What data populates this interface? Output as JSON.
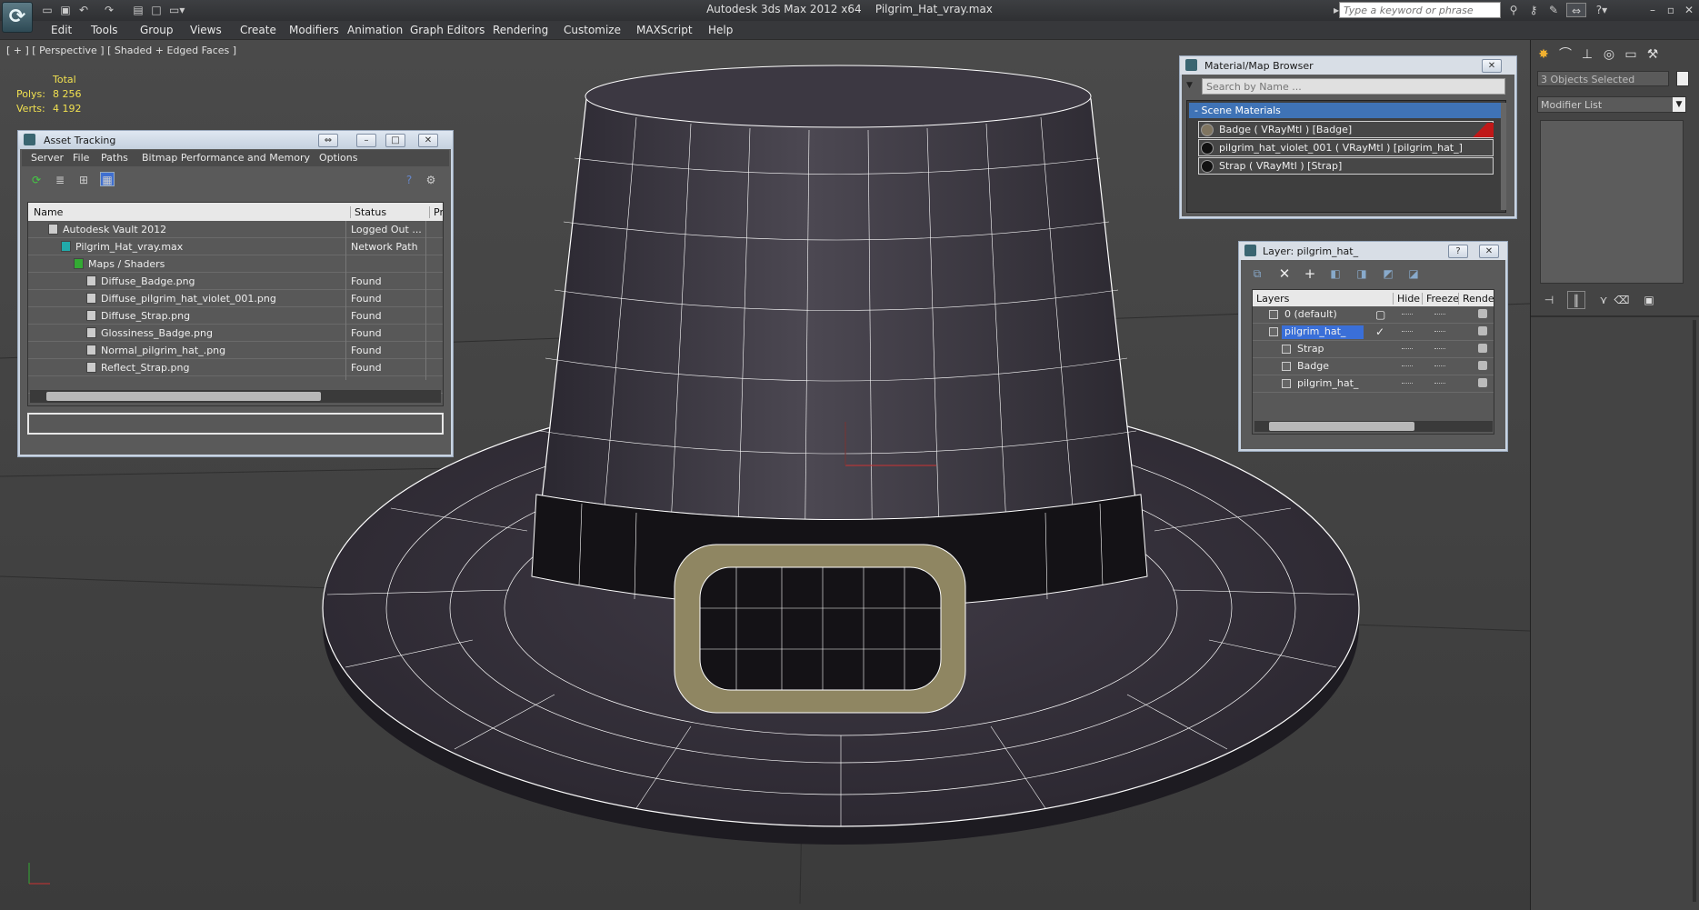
{
  "app": {
    "title": "Autodesk 3ds Max  2012 x64",
    "file": "Pilgrim_Hat_vray.max",
    "logo": "3ds-max-logo",
    "search_placeholder": "Type a keyword or phrase"
  },
  "menu": [
    "Edit",
    "Tools",
    "Group",
    "Views",
    "Create",
    "Modifiers",
    "Animation",
    "Graph Editors",
    "Rendering",
    "Customize",
    "MAXScript",
    "Help"
  ],
  "viewport": {
    "label": "[ + ] [ Perspective ] [ Shaded + Edged Faces ]",
    "stats": {
      "header": "Total",
      "polys_label": "Polys:",
      "polys": "8 256",
      "verts_label": "Verts:",
      "verts": "4 192"
    },
    "colors": {
      "bg": "#454545",
      "hat": "#3a3640",
      "wire": "#ffffff",
      "buckle": "#8f8662"
    }
  },
  "asset_tracking": {
    "title": "Asset Tracking",
    "menu": [
      "Server",
      "File",
      "Paths",
      "Bitmap Performance and Memory",
      "Options"
    ],
    "columns": [
      "Name",
      "Status",
      "Pro"
    ],
    "rows": [
      {
        "name": "Autodesk Vault 2012",
        "status": "Logged Out ...",
        "indent": 0,
        "icon": "vault-icon"
      },
      {
        "name": "Pilgrim_Hat_vray.max",
        "status": "Network Path",
        "indent": 1,
        "icon": "max-file-icon"
      },
      {
        "name": "Maps / Shaders",
        "status": "",
        "indent": 2,
        "icon": "maps-icon"
      },
      {
        "name": "Diffuse_Badge.png",
        "status": "Found",
        "indent": 3,
        "icon": "bitmap-icon"
      },
      {
        "name": "Diffuse_pilgrim_hat_violet_001.png",
        "status": "Found",
        "indent": 3,
        "icon": "bitmap-icon"
      },
      {
        "name": "Diffuse_Strap.png",
        "status": "Found",
        "indent": 3,
        "icon": "bitmap-icon"
      },
      {
        "name": "Glossiness_Badge.png",
        "status": "Found",
        "indent": 3,
        "icon": "bitmap-icon"
      },
      {
        "name": "Normal_pilgrim_hat_.png",
        "status": "Found",
        "indent": 3,
        "icon": "bitmap-icon"
      },
      {
        "name": "Reflect_Strap.png",
        "status": "Found",
        "indent": 3,
        "icon": "bitmap-icon"
      }
    ]
  },
  "material_browser": {
    "title": "Material/Map Browser",
    "search_placeholder": "Search by Name ...",
    "section": "- Scene Materials",
    "items": [
      "Badge  ( VRayMtl )  [Badge]",
      "pilgrim_hat_violet_001  ( VRayMtl )  [pilgrim_hat_]",
      "Strap  ( VRayMtl )  [Strap]"
    ]
  },
  "layer_window": {
    "title": "Layer: pilgrim_hat_",
    "columns": [
      "Layers",
      "Hide",
      "Freeze",
      "Rende"
    ],
    "rows": [
      {
        "name": "0 (default)",
        "indent": 0,
        "selected": false
      },
      {
        "name": "pilgrim_hat_",
        "indent": 0,
        "selected": true
      },
      {
        "name": "Strap",
        "indent": 1,
        "selected": false
      },
      {
        "name": "Badge",
        "indent": 1,
        "selected": false
      },
      {
        "name": "pilgrim_hat_",
        "indent": 1,
        "selected": false
      }
    ]
  },
  "command_panel": {
    "selection": "3 Objects Selected",
    "modifier_list": "Modifier List"
  }
}
